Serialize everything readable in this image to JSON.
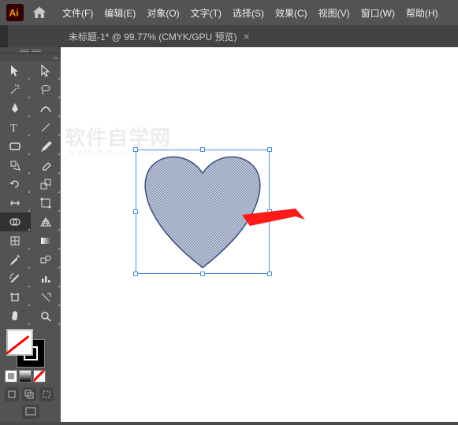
{
  "app": {
    "logo_text": "Ai"
  },
  "menu": {
    "file": "文件(F)",
    "edit": "编辑(E)",
    "object": "对象(O)",
    "type": "文字(T)",
    "select": "选择(S)",
    "effect": "效果(C)",
    "view": "视图(V)",
    "window": "窗口(W)",
    "help": "帮助(H)"
  },
  "tab": {
    "title": "未标题-1* @ 99.77% (CMYK/GPU 预览)",
    "close": "×"
  },
  "watermark": {
    "main": "软件自学网",
    "sub": "WWW.RJSZXW.COM"
  },
  "tools_left": [
    "selection",
    "direct-selection",
    "magic-wand",
    "lasso",
    "pen",
    "curvature",
    "type",
    "line",
    "rectangle",
    "paintbrush",
    "shaper",
    "eraser",
    "rotate",
    "scale",
    "width",
    "free-transform",
    "shape-builder",
    "perspective",
    "mesh",
    "gradient",
    "eyedropper",
    "blend",
    "symbol-sprayer",
    "graph",
    "artboard",
    "slice",
    "hand",
    "zoom"
  ]
}
